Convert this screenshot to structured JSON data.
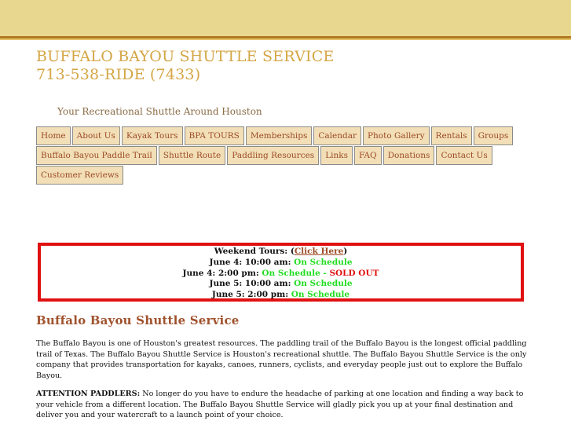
{
  "header": {
    "title_line1": "BUFFALO BAYOU SHUTTLE SERVICE",
    "title_line2": "713-538-RIDE (7433)",
    "tagline": "Your Recreational Shuttle Around Houston"
  },
  "nav": {
    "row1": [
      "Home",
      "About Us",
      "Kayak Tours",
      "BPA TOURS",
      "Memberships",
      "Calendar",
      "Photo Gallery",
      "Rentals",
      "Groups"
    ],
    "row2": [
      "Buffalo Bayou Paddle Trail",
      "Shuttle Route",
      "Paddling Resources",
      "Links",
      "FAQ",
      "Donations",
      "Contact Us"
    ],
    "row3": [
      "Customer Reviews"
    ]
  },
  "notice": {
    "heading": "Weekend Tours: (",
    "link": "Click Here",
    "heading_end": ")",
    "items": [
      {
        "label": "June 4: 10:00 am:",
        "status": "On Schedule",
        "extra_sep": "",
        "extra": ""
      },
      {
        "label": "June 4: 2:00 pm:",
        "status": "On Schedule",
        "extra_sep": " - ",
        "extra": "SOLD OUT"
      },
      {
        "label": "June 5: 10:00 am:",
        "status": "On Schedule",
        "extra_sep": "",
        "extra": ""
      },
      {
        "label": "June 5: 2:00 pm:",
        "status": "On Schedule",
        "extra_sep": "",
        "extra": ""
      }
    ]
  },
  "main": {
    "section_title": "Buffalo Bayou Shuttle Service",
    "para1": "The Buffalo Bayou is one of Houston's greatest resources. The paddling trail of the Buffalo Bayou is the longest official paddling trail of Texas. The Buffalo Bayou Shuttle Service is Houston's recreational shuttle. The Buffalo Bayou Shuttle Service is the only company that provides transportation for kayaks, canoes, runners, cyclists, and everyday people just out to explore the Buffalo Bayou.",
    "para2_lead": "ATTENTION PADDLERS:",
    "para2": " No longer do you have to endure the headache of parking at one location and finding a way back to your vehicle from a different location. The Buffalo Bayou Shuttle Service will gladly pick you up at your final destination and deliver you and your watercraft to a launch point of your choice."
  },
  "colors": {
    "topbar": "#e8d78f",
    "title": "#d4a645",
    "nav_bg": "#f2dfb7",
    "nav_text": "#9c4a26",
    "notice_border": "#e01010",
    "status_green": "#22dd22"
  }
}
